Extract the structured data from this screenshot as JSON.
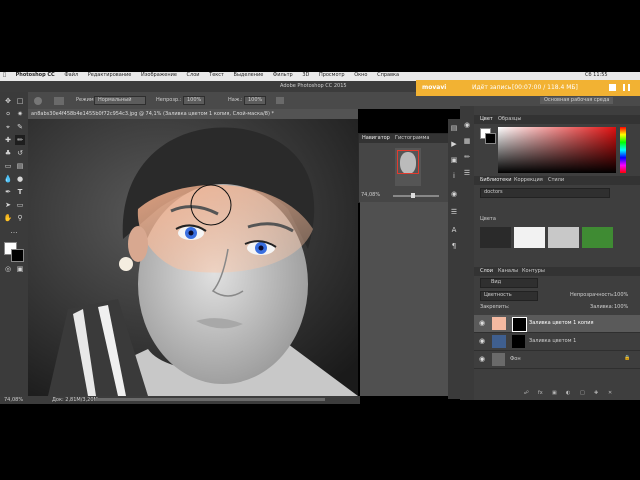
{
  "menubar": {
    "items": [
      "Photoshop CC",
      "Файл",
      "Редактирование",
      "Изображение",
      "Слои",
      "Текст",
      "Выделение",
      "Фильтр",
      "3D",
      "Просмотр",
      "Окно",
      "Справка"
    ],
    "right_text": "Сб 11:55"
  },
  "options_bar": {
    "mode_label": "Режим:",
    "mode_value": "Нормальный",
    "opacity_label": "Непрозр.:",
    "opacity_value": "100%",
    "flow_label": "Наж.:",
    "flow_value": "100%"
  },
  "app_title": "Adobe Photoshop CC 2015",
  "workspace": "Основная рабочая среда",
  "recording": {
    "brand": "movavi",
    "status": "Идёт запись",
    "time": "[00:07:00 / 118.4 МБ]"
  },
  "document": {
    "tab_title": "an8abs30e4f458b4e1455b0f72c954c3.jpg @ 74,1% (Заливка цветом 1 копия, Слой-маска/8) *",
    "zoom": "74,08%",
    "doc_size": "Док: 2,81M/3,20M"
  },
  "navigator": {
    "tab1": "Навигатор",
    "tab2": "Гистограмма",
    "zoom": "74,08%"
  },
  "color_panel": {
    "tab1": "Цвет",
    "tab2": "Образцы"
  },
  "libraries_panel": {
    "tab1": "Библиотеки",
    "tab2": "Коррекция",
    "tab3": "Стили",
    "library_name": "doctors",
    "section": "Цвета",
    "swatches": [
      "#2a2a2a",
      "#f2f2f2",
      "#c8c8c8",
      "#3f8b33"
    ]
  },
  "layers_panel": {
    "tab1": "Слои",
    "tab2": "Каналы",
    "tab3": "Контуры",
    "filter_label": "Вид",
    "blend_mode": "Цветность",
    "opacity_label": "Непрозрачность:",
    "opacity_value": "100%",
    "lock_label": "Закрепить:",
    "fill_label": "Заливка:",
    "fill_value": "100%",
    "layers": [
      {
        "name": "Заливка цветом 1 копия",
        "color": "#f4b9a1"
      },
      {
        "name": "Заливка цветом 1",
        "color": "#3f5f8f"
      },
      {
        "name": "Фон",
        "color": ""
      }
    ]
  }
}
